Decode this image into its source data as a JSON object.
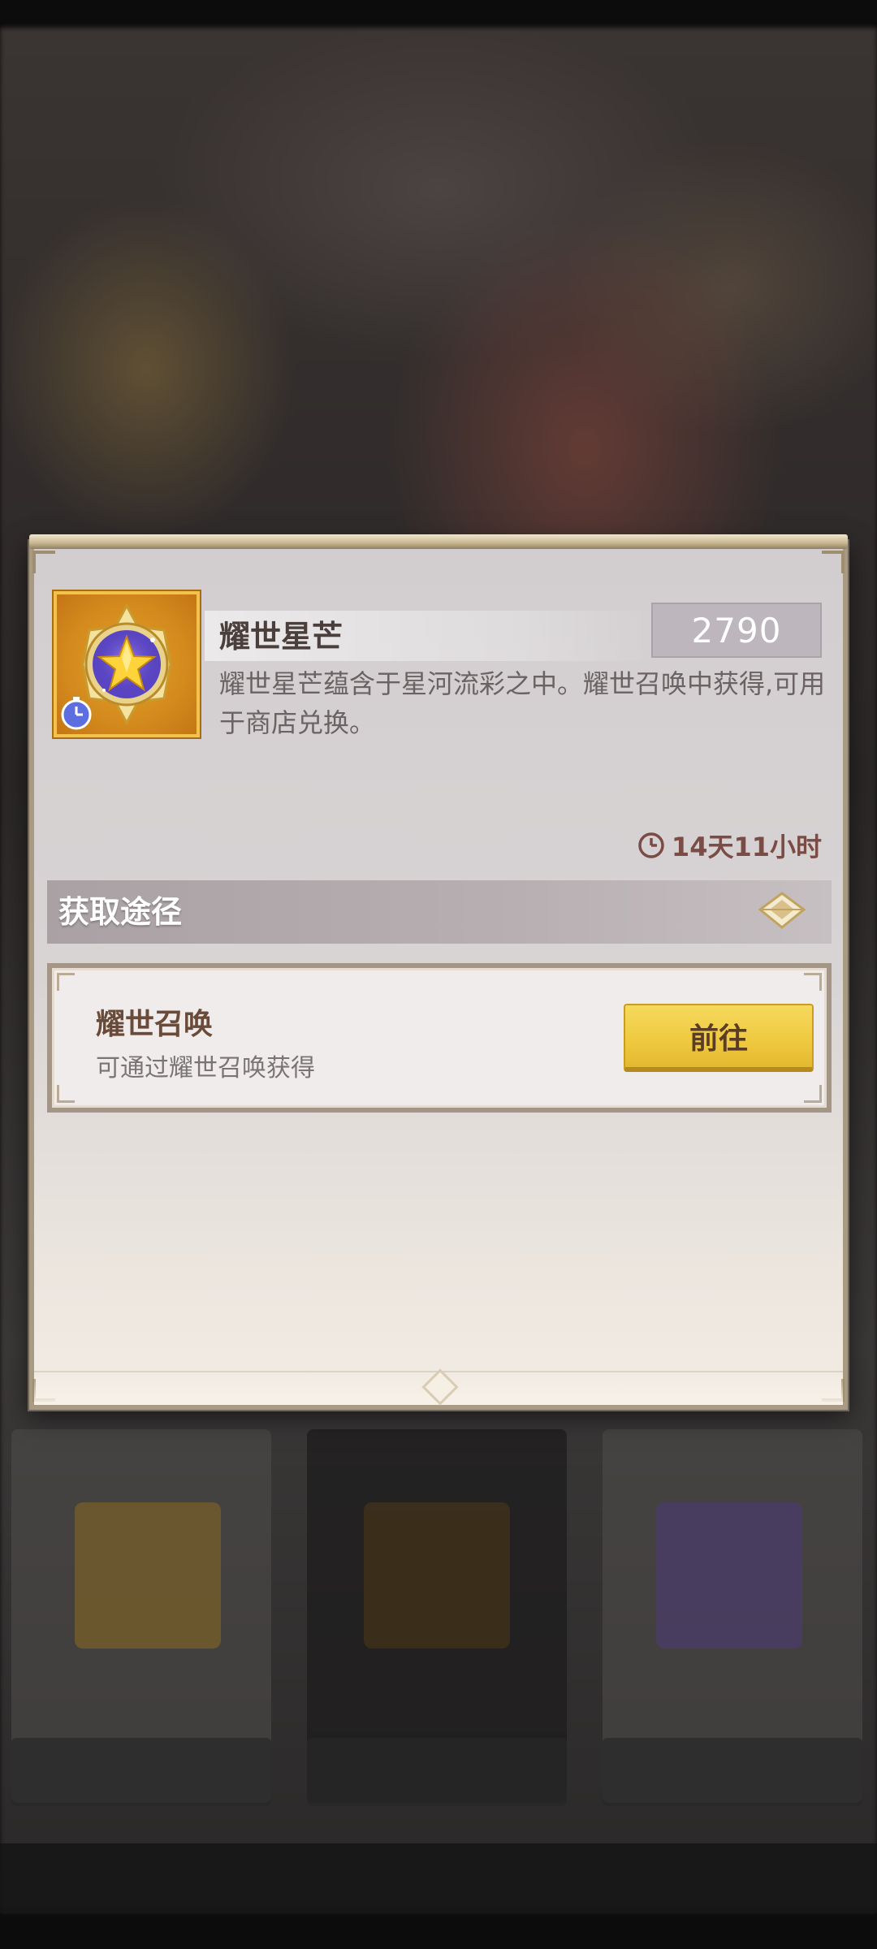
{
  "item": {
    "name": "耀世星芒",
    "count": "2790",
    "description": "耀世星芒蕴含于星河流彩之中。耀世召唤中获得,可用于商店兑换。",
    "icon": "star-medal-icon",
    "timer_icon": "clock-icon",
    "expires_in": "14天11小时"
  },
  "section": {
    "title": "获取途径",
    "icon": "diamond-ornament-icon"
  },
  "sources": [
    {
      "title": "耀世召唤",
      "description": "可通过耀世召唤获得",
      "button_label": "前往"
    }
  ],
  "colors": {
    "accent_gold": "#f2c24a",
    "button_yellow": "#eec93f",
    "timer_text": "#7b4b45"
  }
}
